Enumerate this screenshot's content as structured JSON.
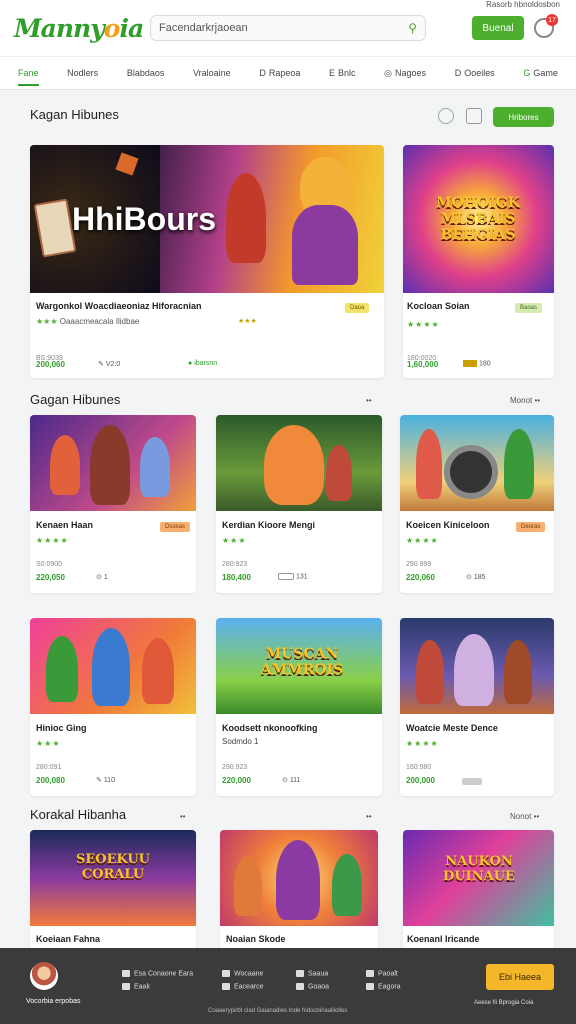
{
  "header": {
    "logo_main": "Manny",
    "logo_accent": "o",
    "logo_end": "ia",
    "search_value": "Facendarkrjaoean",
    "search_placeholder": "Search",
    "button": "Buenal",
    "bell_count": "17",
    "top_link": "Rasorb hbnoldosbon"
  },
  "nav": [
    {
      "label": "Fane",
      "icon": ""
    },
    {
      "label": "Nodlers",
      "icon": ""
    },
    {
      "label": "Blabdaos",
      "icon": ""
    },
    {
      "label": "Vraloaine",
      "icon": ""
    },
    {
      "label": "Rapeoa",
      "icon": "D"
    },
    {
      "label": "Bnlc",
      "icon": "E"
    },
    {
      "label": "Nagoes",
      "icon": "◎"
    },
    {
      "label": "Ooeiles",
      "icon": "D"
    },
    {
      "label": "Game",
      "icon": "G"
    }
  ],
  "sections": {
    "s1": {
      "title": "Kagan Hibunes",
      "button": "Hribores"
    },
    "s2": {
      "title": "Gagan Hibunes",
      "more": "Monot ••"
    },
    "s3": {
      "title": "Korakal Hibanha",
      "more": "Nonot ••"
    }
  },
  "featured": {
    "banner": "HhiBours",
    "title": "Wargonkol Woacdiaeoniaz Hiforacnian",
    "subtitle": "Oaaacmeacala Ilidbae",
    "stars": "★★★",
    "meta": "BS:9039",
    "price": "200,060",
    "icon_label": "V2:0",
    "tag": "Daoa",
    "green_label": "ibarsnn"
  },
  "side_featured": {
    "banner": "MOHOIGK MLSBAIS BEHGIAS",
    "title": "Kocloan Soian",
    "stars": "★★★★",
    "meta": "180:0020",
    "price": "1,60,000",
    "tag": "Baoas",
    "extra": "180"
  },
  "row1": [
    {
      "title": "Kenaen Haan",
      "stars": "★★★★",
      "meta": "S0:0900",
      "price": "220,050",
      "extra": "1",
      "tag": "Dsoxas"
    },
    {
      "title": "Kerdian Kioore Mengi",
      "stars": "★★★",
      "meta": "280:923",
      "price": "180,400",
      "extra": "131"
    },
    {
      "title": "Koeicen Kiniceloon",
      "stars": "★★★★",
      "meta": "290.999",
      "price": "220,060",
      "extra": "185",
      "tag": "Deoras"
    }
  ],
  "row2": [
    {
      "title": "Hinioc Ging",
      "stars": "★★★",
      "meta": "280:091",
      "price": "200,080",
      "extra": "110"
    },
    {
      "title": "Koodsett nkonoofking",
      "subtitle": "Sodmdo 1",
      "meta": "290.923",
      "price": "220,000",
      "extra": "111"
    },
    {
      "title": "Woatcie Meste Dence",
      "stars": "★★★★",
      "meta": "160:980",
      "price": "200,000",
      "extra": ""
    }
  ],
  "row3": [
    {
      "banner": "SEOEKUU CORALU",
      "title": "Koeiaan Fahna"
    },
    {
      "banner": "",
      "title": "Noaian Skode"
    },
    {
      "banner": "NAUKON DUINAUE",
      "title": "Koenanl Iricande"
    }
  ],
  "row2_banner": "MUSCAN AMMROIS",
  "footer": {
    "name": "Vocorbia erpobas",
    "col1": [
      "Esa Conaone Eara",
      "Eaak"
    ],
    "col2": [
      "Wocaane",
      "Eacearce"
    ],
    "col3": [
      "Saaua",
      "Goaoa"
    ],
    "col4": [
      "Paoalt",
      "Eagora"
    ],
    "button": "Ebi Haeea",
    "right_text": "Aeese fii Bprogia Coia",
    "copyright": "Coaaerypirbt clad Gaianadies Inde hidocbiriaalilolles"
  },
  "colors": {
    "green": "#4caf2e",
    "orange": "#f5b72a",
    "footer": "#3b3b3b"
  }
}
